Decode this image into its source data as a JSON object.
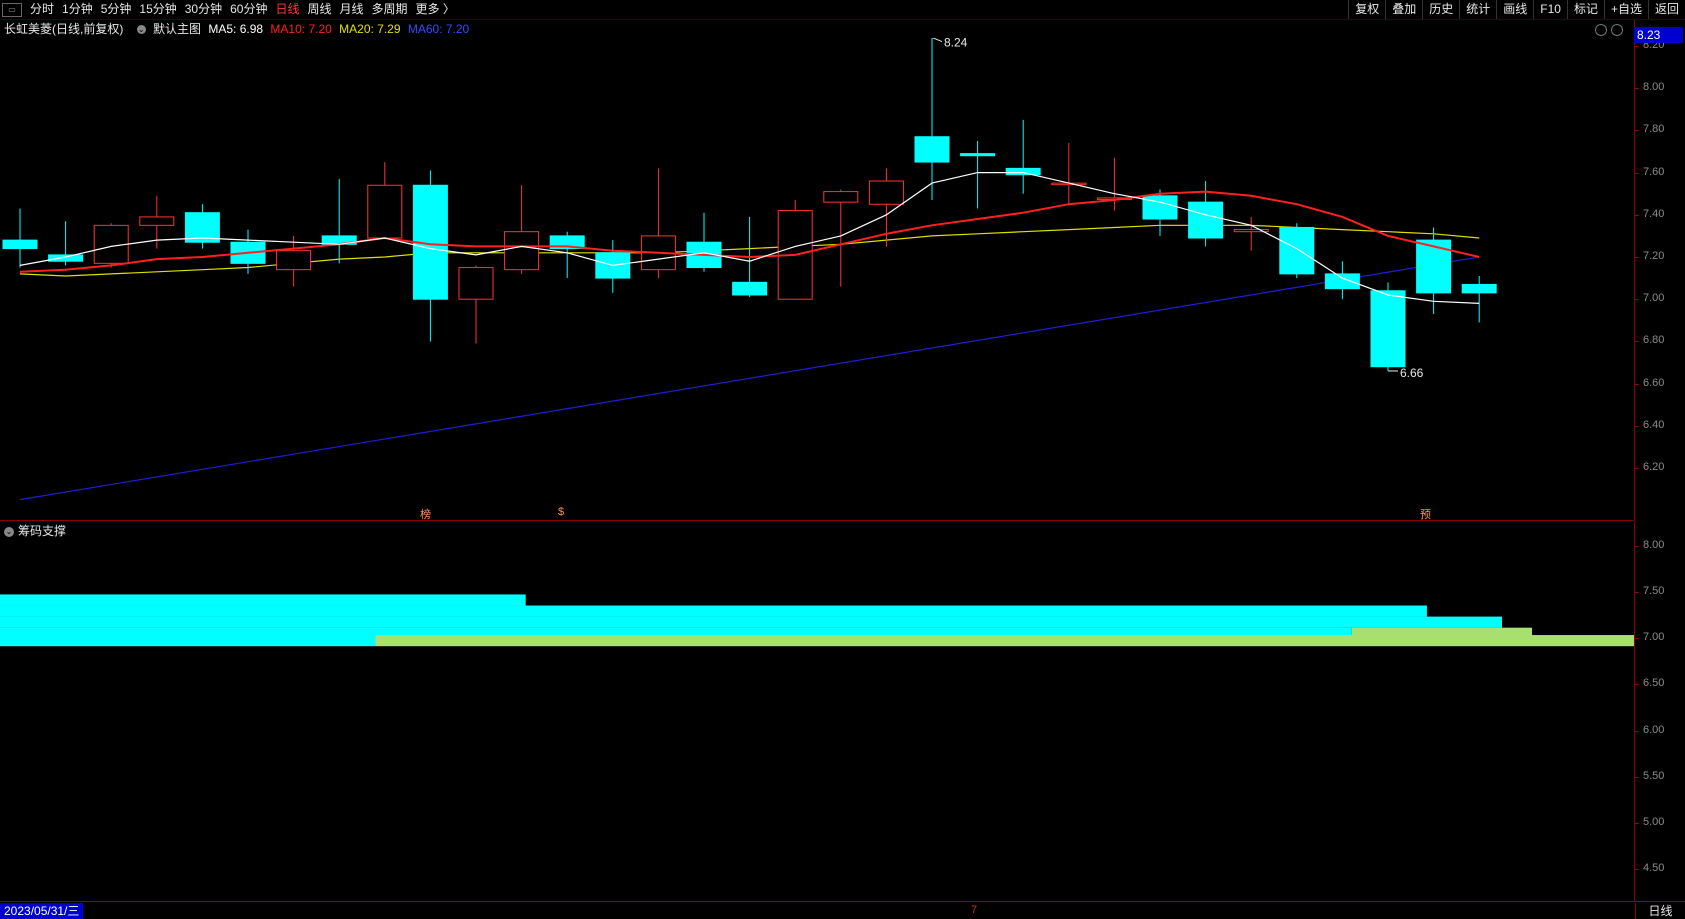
{
  "toolbar": {
    "app_icon": "window-icon",
    "periods": [
      "分时",
      "1分钟",
      "5分钟",
      "15分钟",
      "30分钟",
      "60分钟",
      "日线",
      "周线",
      "月线",
      "多周期",
      "更多 〉"
    ],
    "active_period": "日线",
    "tools": [
      "复权",
      "叠加",
      "历史",
      "统计",
      "画线",
      "F10",
      "标记",
      "+自选",
      "返回"
    ]
  },
  "info": {
    "stock": "长虹美菱(日线,前复权)",
    "template": "默认主图",
    "ma5": "MA5: 6.98",
    "ma10": "MA10: 7.20",
    "ma20": "MA20: 7.29",
    "ma60": "MA60: 7.20"
  },
  "colors": {
    "up": "#ff3232",
    "down": "#00ffff",
    "ma5": "#ffffff",
    "ma10": "#ff2020",
    "ma20": "#e0e000",
    "ma60": "#1f1fd0",
    "chip_profit": "#00ffff",
    "chip_loss": "#a8e070"
  },
  "price_axis": {
    "current_price": "8.23",
    "labels": [
      "8.20",
      "8.00",
      "7.80",
      "7.60",
      "7.40",
      "7.20",
      "7.00",
      "6.80",
      "6.60",
      "6.40",
      "6.20"
    ]
  },
  "chip_axis": {
    "labels": [
      "8.00",
      "7.50",
      "7.00",
      "6.50",
      "6.00",
      "5.50",
      "5.00",
      "4.50"
    ]
  },
  "sub_panel": {
    "title": "筹码支撑"
  },
  "annotations": {
    "high": "8.24",
    "low": "6.66"
  },
  "markers": [
    "榜",
    "$",
    "预"
  ],
  "bottom": {
    "date": "2023/05/31/三",
    "month_tick": "7",
    "period": "日线"
  },
  "chart_data": {
    "type": "candlestick",
    "candles": [
      {
        "o": 7.28,
        "c": 7.24,
        "h": 7.43,
        "l": 7.15
      },
      {
        "o": 7.21,
        "c": 7.18,
        "h": 7.37,
        "l": 7.16
      },
      {
        "o": 7.17,
        "c": 7.35,
        "h": 7.36,
        "l": 7.15
      },
      {
        "o": 7.35,
        "c": 7.39,
        "h": 7.49,
        "l": 7.24
      },
      {
        "o": 7.41,
        "c": 7.27,
        "h": 7.45,
        "l": 7.24
      },
      {
        "o": 7.27,
        "c": 7.17,
        "h": 7.33,
        "l": 7.12
      },
      {
        "o": 7.14,
        "c": 7.23,
        "h": 7.3,
        "l": 7.06
      },
      {
        "o": 7.3,
        "c": 7.26,
        "h": 7.57,
        "l": 7.17
      },
      {
        "o": 7.29,
        "c": 7.54,
        "h": 7.65,
        "l": 7.29
      },
      {
        "o": 7.54,
        "c": 7.0,
        "h": 7.61,
        "l": 6.8
      },
      {
        "o": 7.0,
        "c": 7.15,
        "h": 7.16,
        "l": 6.79
      },
      {
        "o": 7.14,
        "c": 7.32,
        "h": 7.54,
        "l": 7.12
      },
      {
        "o": 7.3,
        "c": 7.24,
        "h": 7.32,
        "l": 7.1
      },
      {
        "o": 7.22,
        "c": 7.1,
        "h": 7.28,
        "l": 7.03
      },
      {
        "o": 7.14,
        "c": 7.3,
        "h": 7.62,
        "l": 7.1
      },
      {
        "o": 7.27,
        "c": 7.15,
        "h": 7.41,
        "l": 7.13
      },
      {
        "o": 7.08,
        "c": 7.02,
        "h": 7.39,
        "l": 7.01
      },
      {
        "o": 7.0,
        "c": 7.42,
        "h": 7.47,
        "l": 7.0
      },
      {
        "o": 7.46,
        "c": 7.51,
        "h": 7.52,
        "l": 7.06
      },
      {
        "o": 7.45,
        "c": 7.56,
        "h": 7.62,
        "l": 7.25
      },
      {
        "o": 7.77,
        "c": 7.65,
        "h": 8.24,
        "l": 7.47
      },
      {
        "o": 7.69,
        "c": 7.68,
        "h": 7.75,
        "l": 7.43
      },
      {
        "o": 7.62,
        "c": 7.59,
        "h": 7.85,
        "l": 7.5
      },
      {
        "o": 7.55,
        "c": 7.55,
        "h": 7.74,
        "l": 7.45
      },
      {
        "o": 7.48,
        "c": 7.48,
        "h": 7.67,
        "l": 7.42
      },
      {
        "o": 7.49,
        "c": 7.38,
        "h": 7.52,
        "l": 7.3
      },
      {
        "o": 7.46,
        "c": 7.29,
        "h": 7.56,
        "l": 7.25
      },
      {
        "o": 7.32,
        "c": 7.33,
        "h": 7.39,
        "l": 7.23
      },
      {
        "o": 7.34,
        "c": 7.12,
        "h": 7.36,
        "l": 7.1
      },
      {
        "o": 7.12,
        "c": 7.05,
        "h": 7.18,
        "l": 7.0
      },
      {
        "o": 7.04,
        "c": 6.68,
        "h": 7.08,
        "l": 6.66
      },
      {
        "o": 7.28,
        "c": 7.03,
        "h": 7.34,
        "l": 6.93
      },
      {
        "o": 7.07,
        "c": 7.03,
        "h": 7.11,
        "l": 6.89
      }
    ],
    "ma5": [
      7.16,
      7.2,
      7.25,
      7.28,
      7.29,
      7.28,
      7.27,
      7.26,
      7.29,
      7.24,
      7.21,
      7.25,
      7.22,
      7.16,
      7.19,
      7.22,
      7.18,
      7.25,
      7.3,
      7.4,
      7.55,
      7.6,
      7.6,
      7.55,
      7.5,
      7.46,
      7.4,
      7.35,
      7.24,
      7.1,
      7.02,
      6.99,
      6.98
    ],
    "ma10": [
      7.13,
      7.14,
      7.16,
      7.19,
      7.2,
      7.22,
      7.24,
      7.26,
      7.29,
      7.26,
      7.25,
      7.25,
      7.25,
      7.23,
      7.22,
      7.21,
      7.2,
      7.21,
      7.26,
      7.31,
      7.35,
      7.38,
      7.41,
      7.45,
      7.47,
      7.5,
      7.51,
      7.49,
      7.45,
      7.39,
      7.3,
      7.25,
      7.2
    ],
    "ma20": [
      7.12,
      7.11,
      7.12,
      7.13,
      7.14,
      7.15,
      7.17,
      7.19,
      7.2,
      7.22,
      7.22,
      7.22,
      7.22,
      7.22,
      7.22,
      7.23,
      7.24,
      7.25,
      7.26,
      7.28,
      7.3,
      7.31,
      7.32,
      7.33,
      7.34,
      7.35,
      7.35,
      7.35,
      7.34,
      7.33,
      7.32,
      7.31,
      7.29
    ],
    "ma60_start": 6.05,
    "ma60_end": 7.2,
    "chip_rows": [
      {
        "price": 7.42,
        "profit": 0.35,
        "loss": 0.0
      },
      {
        "price": 7.3,
        "profit": 0.95,
        "loss": 0.0
      },
      {
        "price": 7.18,
        "profit": 1.0,
        "loss": 0.0
      },
      {
        "price": 7.06,
        "profit": 0.9,
        "loss": 0.12
      },
      {
        "price": 6.98,
        "profit": 0.25,
        "loss": 0.85
      }
    ]
  }
}
